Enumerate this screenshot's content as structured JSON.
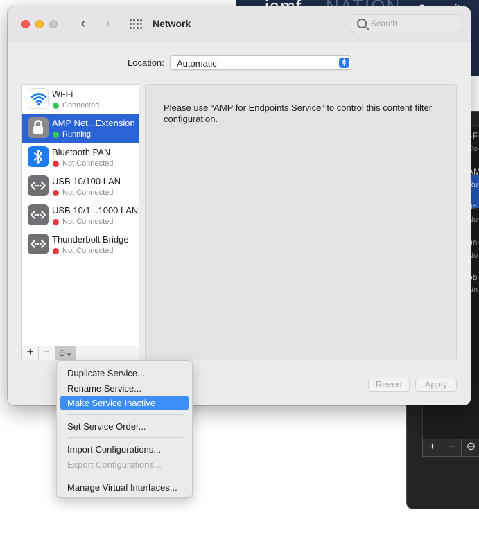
{
  "background": {
    "brand_left": "jamf",
    "brand_right": "NATION",
    "community": "Community",
    "partial_texts": [
      "i-F",
      "Co",
      "AMP",
      "Ru",
      "ue",
      "No",
      "un",
      "No",
      "ob",
      "No"
    ],
    "controls": [
      "+",
      "−",
      "⊝"
    ]
  },
  "window": {
    "title": "Network",
    "search_placeholder": "Search",
    "back_symbol": "‹",
    "forward_symbol": "›"
  },
  "location": {
    "label": "Location:",
    "value": "Automatic"
  },
  "services": [
    {
      "name": "Wi-Fi",
      "status": "Connected",
      "status_color": "#34c759",
      "icon": "wifi-icon"
    },
    {
      "name": "AMP Net...Extension",
      "status": "Running",
      "status_color": "#34c759",
      "icon": "lock-icon",
      "selected": true
    },
    {
      "name": "Bluetooth PAN",
      "status": "Not Connected",
      "status_color": "#e5393b",
      "icon": "bluetooth-icon"
    },
    {
      "name": "USB 10/100 LAN",
      "status": "Not Connected",
      "status_color": "#e5393b",
      "icon": "ethernet-icon"
    },
    {
      "name": "USB 10/1...1000 LAN",
      "status": "Not Connected",
      "status_color": "#e5393b",
      "icon": "ethernet-icon"
    },
    {
      "name": "Thunderbolt Bridge",
      "status": "Not Connected",
      "status_color": "#e5393b",
      "icon": "ethernet-icon"
    }
  ],
  "list_controls": {
    "add": "+",
    "remove": "−",
    "action": "⊝⌄"
  },
  "detail": {
    "message": "Please use “AMP for Endpoints Service” to control this content filter configuration."
  },
  "buttons": {
    "revert": "Revert",
    "apply": "Apply"
  },
  "menu": {
    "items": [
      {
        "label": "Duplicate Service...",
        "state": "normal"
      },
      {
        "label": "Rename Service...",
        "state": "normal"
      },
      {
        "label": "Make Service Inactive",
        "state": "highlighted"
      },
      {
        "label": "Set Service Order...",
        "state": "normal"
      },
      {
        "label": "Import Configurations...",
        "state": "normal"
      },
      {
        "label": "Export Configurations...",
        "state": "disabled"
      },
      {
        "label": "Manage Virtual Interfaces...",
        "state": "normal"
      }
    ]
  },
  "colors": {
    "accent": "#2a63d5",
    "menu_highlight": "#3d8ef7",
    "connected": "#34c759",
    "not_connected": "#e5393b"
  }
}
